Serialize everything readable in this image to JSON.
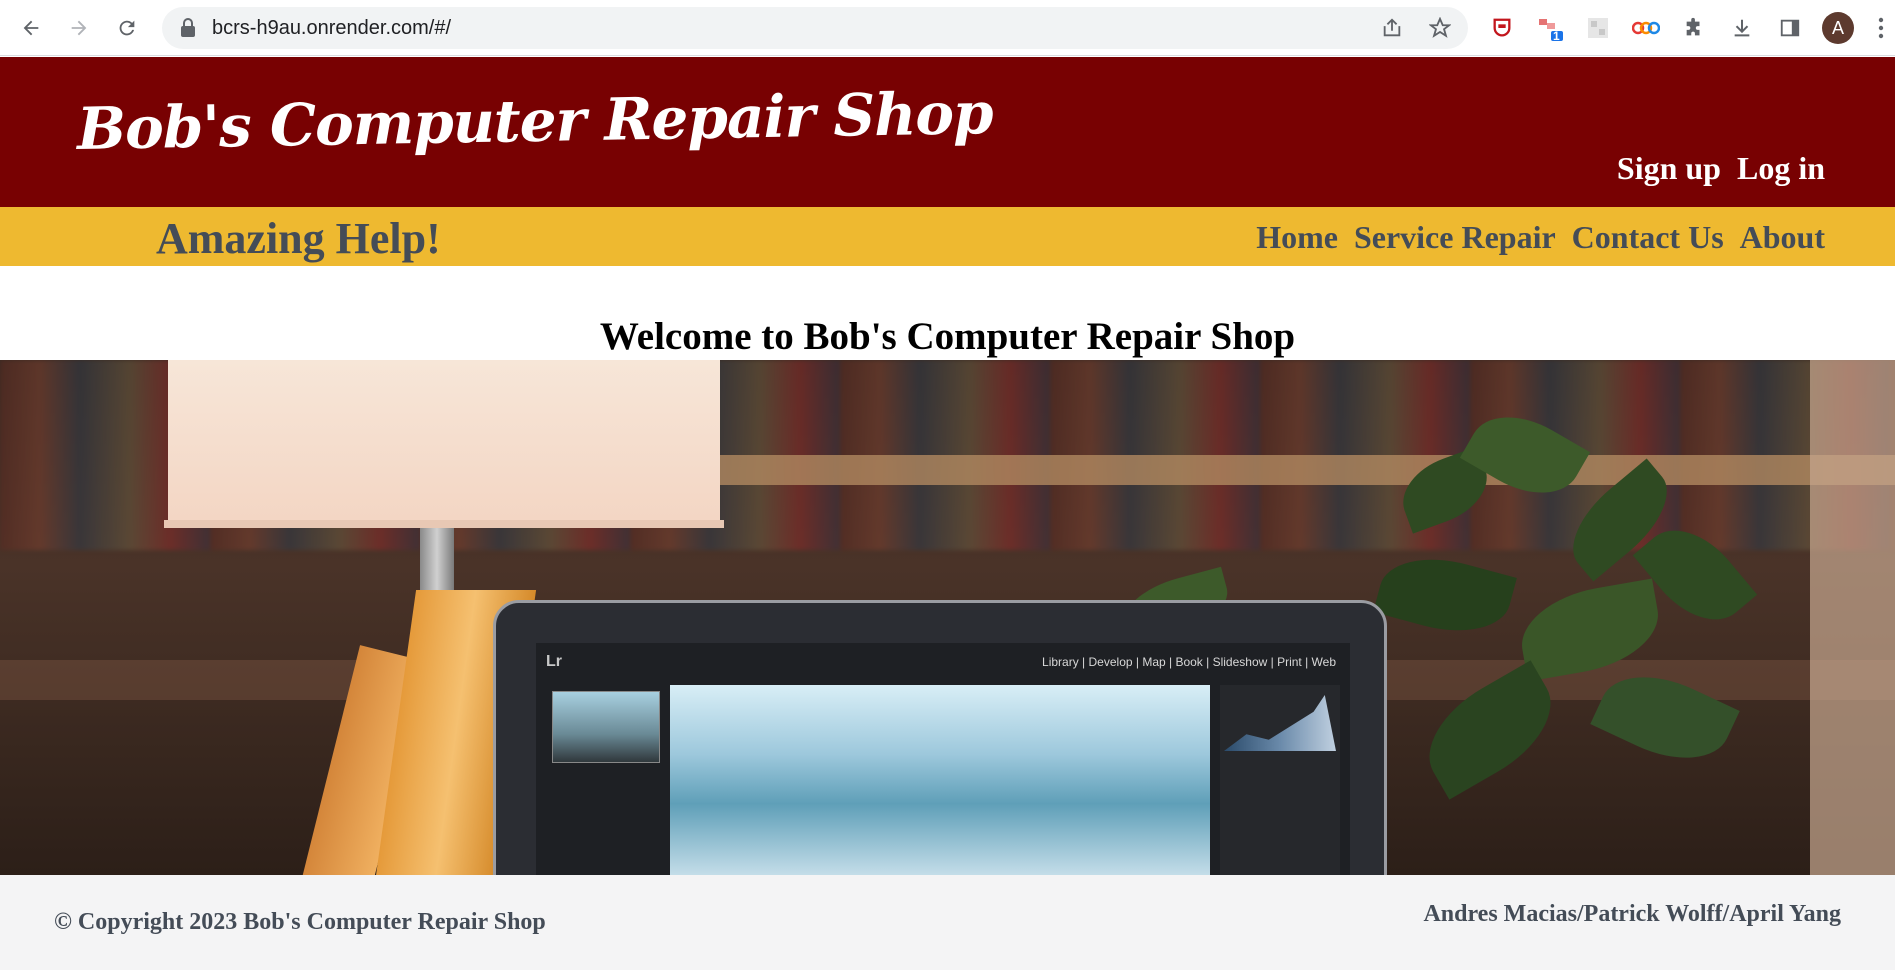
{
  "browser": {
    "url": "bcrs-h9au.onrender.com/#/",
    "avatar_initial": "A",
    "extension_badge": "1",
    "icons": [
      "back-icon",
      "forward-icon",
      "reload-icon",
      "lock-icon",
      "share-icon",
      "star-icon",
      "puzzle-icon",
      "download-icon",
      "sidepanel-icon",
      "menu-icon"
    ]
  },
  "header": {
    "title": "Bob's Computer Repair Shop",
    "auth": {
      "signup": "Sign up",
      "login": "Log in"
    }
  },
  "subbar": {
    "tagline": "Amazing Help!",
    "nav": {
      "home": "Home",
      "service": "Service Repair",
      "contact": "Contact Us",
      "about": "About"
    }
  },
  "main": {
    "welcome": "Welcome to Bob's Computer Repair Shop",
    "hero_screen": {
      "logo": "Lr",
      "menu": "Library | Develop | Map | Book | Slideshow | Print | Web"
    }
  },
  "footer": {
    "copyright": "© Copyright 2023 Bob's Computer Repair Shop",
    "credits": "Andres Macias/Patrick Wolff/April Yang"
  },
  "colors": {
    "header_bg": "#780102",
    "subbar_bg": "#eeb930",
    "nav_text": "#444c57",
    "footer_bg": "#f4f4f5"
  }
}
